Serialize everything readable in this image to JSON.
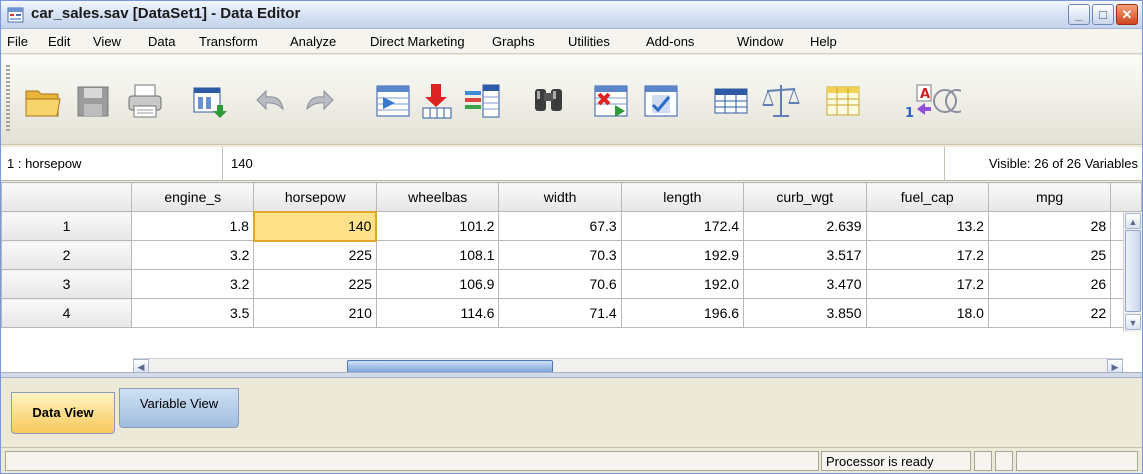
{
  "window": {
    "title": "car_sales.sav [DataSet1] - Data Editor"
  },
  "menu": {
    "items": [
      "File",
      "Edit",
      "View",
      "Data",
      "Transform",
      "Analyze",
      "Direct Marketing",
      "Graphs",
      "Utilities",
      "Add-ons",
      "Window",
      "Help"
    ]
  },
  "toolbar": {
    "icons": [
      "open-folder-icon",
      "save-icon",
      "print-icon",
      "dialog-recall-icon",
      "undo-icon",
      "redo-icon",
      "goto-case-icon",
      "goto-variable-icon",
      "variables-icon",
      "find-icon",
      "insert-cases-icon",
      "insert-variable-icon",
      "split-file-icon",
      "weight-cases-icon",
      "select-cases-icon",
      "value-labels-icon",
      "use-sets-icon"
    ]
  },
  "cellbar": {
    "ref": "1 : horsepow",
    "value": "140",
    "visible": "Visible: 26 of 26 Variables"
  },
  "grid": {
    "columns": [
      "engine_s",
      "horsepow",
      "wheelbas",
      "width",
      "length",
      "curb_wgt",
      "fuel_cap",
      "mpg"
    ],
    "rows": [
      {
        "num": "1",
        "cells": [
          "1.8",
          "140",
          "101.2",
          "67.3",
          "172.4",
          "2.639",
          "13.2",
          "28"
        ]
      },
      {
        "num": "2",
        "cells": [
          "3.2",
          "225",
          "108.1",
          "70.3",
          "192.9",
          "3.517",
          "17.2",
          "25"
        ]
      },
      {
        "num": "3",
        "cells": [
          "3.2",
          "225",
          "106.9",
          "70.6",
          "192.0",
          "3.470",
          "17.2",
          "26"
        ]
      },
      {
        "num": "4",
        "cells": [
          "3.5",
          "210",
          "114.6",
          "71.4",
          "196.6",
          "3.850",
          "18.0",
          "22"
        ]
      }
    ],
    "active": {
      "row": 0,
      "col": 1
    }
  },
  "tabs": {
    "data_view": "Data View",
    "variable_view": "Variable View"
  },
  "status": {
    "text": "Processor is ready"
  }
}
